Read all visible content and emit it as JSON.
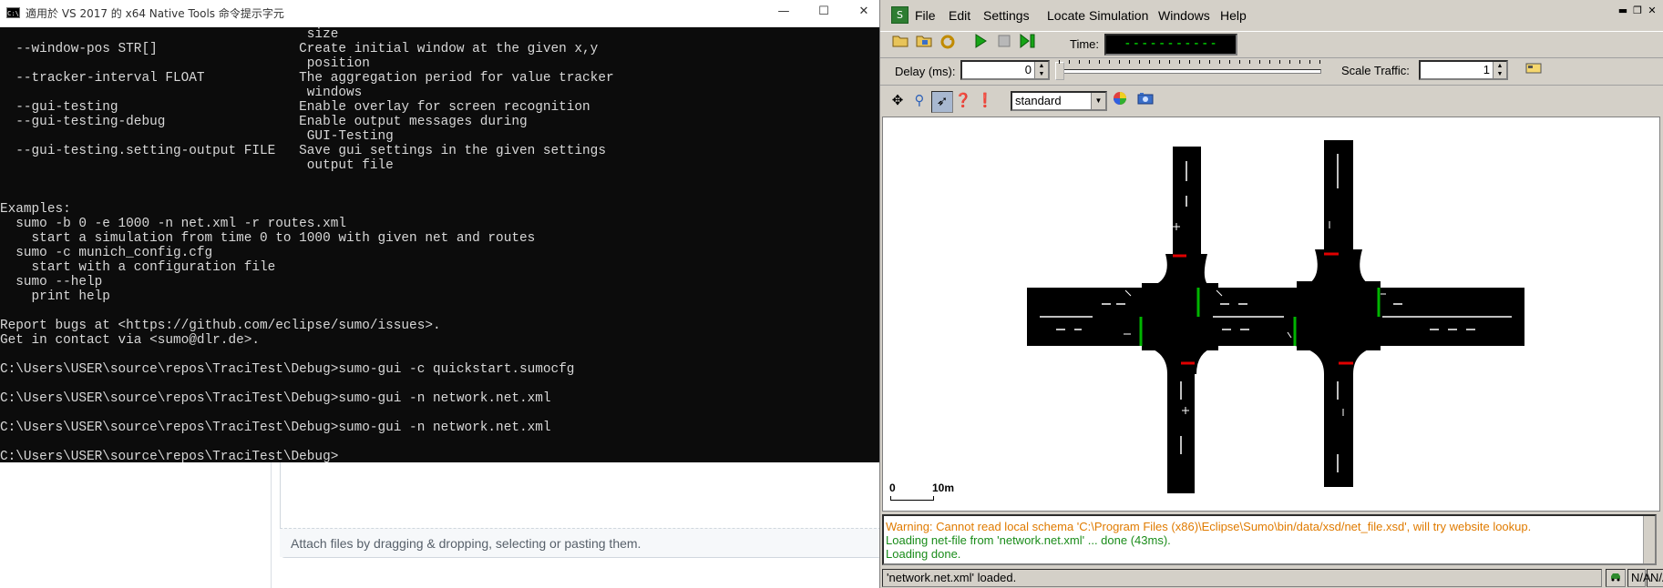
{
  "background": {
    "attach_hint": "Attach files by dragging & dropping, selecting or pasting them."
  },
  "console": {
    "title": "適用於 VS 2017 的 x64 Native Tools 命令提示字元",
    "lines": [
      "                                       size",
      "  --window-pos STR[]                  Create initial window at the given x,y",
      "                                       position",
      "  --tracker-interval FLOAT            The aggregation period for value tracker",
      "                                       windows",
      "  --gui-testing                       Enable overlay for screen recognition",
      "  --gui-testing-debug                 Enable output messages during",
      "                                       GUI-Testing",
      "  --gui-testing.setting-output FILE   Save gui settings in the given settings",
      "                                       output file",
      "",
      "",
      "Examples:",
      "  sumo -b 0 -e 1000 -n net.xml -r routes.xml",
      "    start a simulation from time 0 to 1000 with given net and routes",
      "  sumo -c munich_config.cfg",
      "    start with a configuration file",
      "  sumo --help",
      "    print help",
      "",
      "Report bugs at <https://github.com/eclipse/sumo/issues>.",
      "Get in contact via <sumo@dlr.de>.",
      "",
      "C:\\Users\\USER\\source\\repos\\TraciTest\\Debug>sumo-gui -c quickstart.sumocfg",
      "",
      "C:\\Users\\USER\\source\\repos\\TraciTest\\Debug>sumo-gui -n network.net.xml",
      "",
      "C:\\Users\\USER\\source\\repos\\TraciTest\\Debug>sumo-gui -n network.net.xml",
      "",
      "C:\\Users\\USER\\source\\repos\\TraciTest\\Debug>"
    ]
  },
  "sumo": {
    "menu": [
      "File",
      "Edit",
      "Settings",
      "Locate",
      "Simulation",
      "Windows",
      "Help"
    ],
    "time_label": "Time:",
    "time_value": "-----------",
    "delay_label": "Delay (ms):",
    "delay_value": "0",
    "scale_label": "Scale Traffic:",
    "scale_value": "1",
    "color_scheme": "standard",
    "scale_zero": "0",
    "scale_ten": "10m",
    "log": {
      "warning": "Warning: Cannot read local schema 'C:\\Program Files (x86)\\Eclipse\\Sumo\\bin/data/xsd/net_file.xsd', will try website lookup.",
      "info1": "Loading net-file from 'network.net.xml' ... done (43ms).",
      "info2": "Loading done."
    },
    "status": "'network.net.xml' loaded.",
    "status_cells": [
      "N/A",
      "N/A"
    ],
    "colors": {
      "warning": "#e07b00",
      "info": "#1a8c1a",
      "signal_red": "#e00000",
      "signal_green": "#00b400"
    }
  }
}
